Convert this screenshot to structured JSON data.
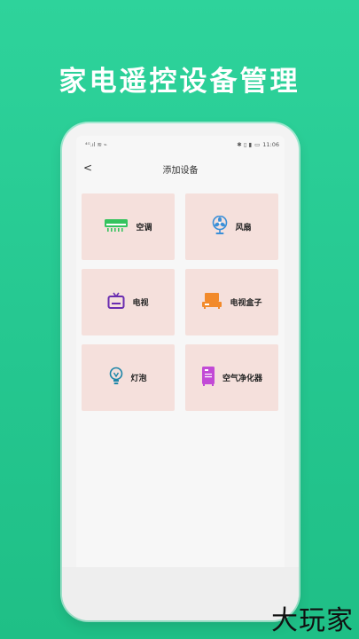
{
  "headline": "家电遥控设备管理",
  "status_bar": {
    "left": "⁴ᴳ.ıl ≋ ⌁",
    "right_icons": "✱ ▯ ▮",
    "battery": "▭",
    "time": "11:06"
  },
  "nav": {
    "back": "<",
    "title": "添加设备"
  },
  "devices": [
    {
      "label": "空调",
      "icon": "air-conditioner-icon",
      "color": "#35c35e"
    },
    {
      "label": "风扇",
      "icon": "fan-icon",
      "color": "#3a8fd8"
    },
    {
      "label": "电视",
      "icon": "tv-icon",
      "color": "#6a2db0"
    },
    {
      "label": "电视盒子",
      "icon": "tv-box-icon",
      "color": "#f28a2b"
    },
    {
      "label": "灯泡",
      "icon": "light-bulb-icon",
      "color": "#1d86a8"
    },
    {
      "label": "空气净化器",
      "icon": "air-purifier-icon",
      "color": "#c24ad6"
    }
  ],
  "watermark": "大玩家"
}
